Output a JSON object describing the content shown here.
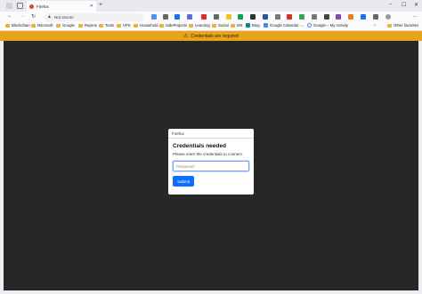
{
  "browser": {
    "tab_title": "Firefox",
    "tab_close": "✕",
    "new_tab": "+",
    "window_controls": [
      "–",
      "☐",
      "✕"
    ]
  },
  "toolbar": {
    "back": "←",
    "forward": "→",
    "reload": "↻",
    "address_warning": "▲",
    "address_text": "Not secure",
    "menu": "…"
  },
  "bookmarks": [
    {
      "label": "Blockchain",
      "icon": "folder-icon"
    },
    {
      "label": "Microsoft",
      "icon": "folder-icon"
    },
    {
      "label": "Google",
      "icon": "folder-icon"
    },
    {
      "label": "Repros",
      "icon": "folder-icon"
    },
    {
      "label": "Tools",
      "icon": "folder-icon"
    },
    {
      "label": "VPS",
      "icon": "folder-icon"
    },
    {
      "label": "Household",
      "icon": "folder-icon"
    },
    {
      "label": "SideProjects",
      "icon": "folder-icon"
    },
    {
      "label": "Learning",
      "icon": "folder-icon"
    },
    {
      "label": "Social",
      "icon": "folder-icon"
    },
    {
      "label": "MS",
      "icon": "folder-icon"
    },
    {
      "label": "Bing",
      "icon": "bing-icon"
    },
    {
      "label": "Google Calendar -...",
      "icon": "calendar-icon"
    },
    {
      "label": "Google – My Activity",
      "icon": "google-icon"
    },
    {
      "label": "Other favorites",
      "icon": "folder-icon"
    }
  ],
  "bookmarks_more": "›",
  "infobar": {
    "icon": "warning-icon",
    "message": "Credentials are required"
  },
  "dialog": {
    "header": "Firefox",
    "heading": "Credentials needed",
    "text": "Please enter the credentials to connect.",
    "password_placeholder": "Password",
    "password_value": "",
    "submit_label": "Submit"
  },
  "colors": {
    "infobar": "#e8a317",
    "content_bg": "#272727",
    "submit_bg": "#0d6efd"
  }
}
